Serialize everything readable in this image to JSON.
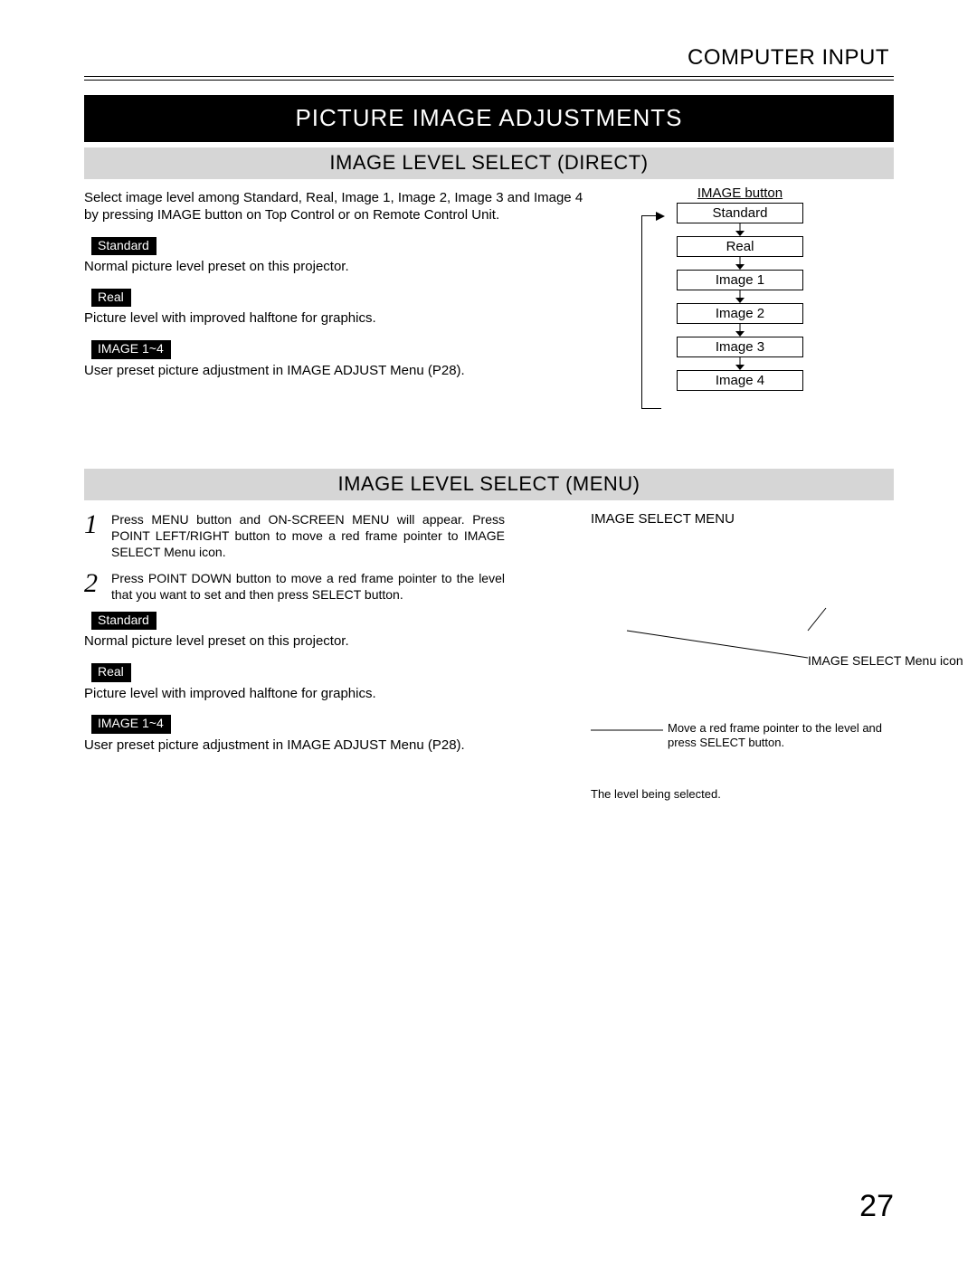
{
  "page": {
    "header": "COMPUTER INPUT",
    "title_banner": "PICTURE IMAGE ADJUSTMENTS",
    "page_number": "27"
  },
  "section_direct": {
    "banner": "IMAGE LEVEL SELECT (DIRECT)",
    "intro": "Select image level among Standard, Real, Image 1, Image 2, Image 3 and Image 4 by pressing IMAGE button on Top Control or on Remote Control Unit.",
    "pills": {
      "standard": {
        "label": "Standard",
        "desc": "Normal picture level preset on this projector."
      },
      "real": {
        "label": "Real",
        "desc": "Picture level with improved halftone for graphics."
      },
      "image14": {
        "label": "IMAGE 1~4",
        "desc": "User preset picture adjustment in IMAGE ADJUST Menu (P28)."
      }
    },
    "diagram": {
      "title": "IMAGE button",
      "boxes": [
        "Standard",
        "Real",
        "Image 1",
        "Image 2",
        "Image 3",
        "Image 4"
      ]
    }
  },
  "section_menu": {
    "banner": "IMAGE LEVEL SELECT (MENU)",
    "steps": [
      {
        "num": "1",
        "text": "Press MENU button and ON-SCREEN MENU will appear.  Press POINT LEFT/RIGHT button to move a red frame pointer to IMAGE SELECT Menu icon."
      },
      {
        "num": "2",
        "text": "Press POINT DOWN button to move a red frame pointer to the level that you want to set and then press SELECT button."
      }
    ],
    "pills": {
      "standard": {
        "label": "Standard",
        "desc": "Normal picture level preset on this projector."
      },
      "real": {
        "label": "Real",
        "desc": "Picture level with improved halftone for graphics."
      },
      "image14": {
        "label": "IMAGE 1~4",
        "desc": "User preset picture adjustment in IMAGE ADJUST Menu (P28)."
      }
    },
    "annot": {
      "title": "IMAGE SELECT MENU",
      "icon_label": "IMAGE SELECT Menu icon",
      "move_label": "Move a red frame pointer to the level and press SELECT button.",
      "level_label": "The level being selected."
    }
  }
}
